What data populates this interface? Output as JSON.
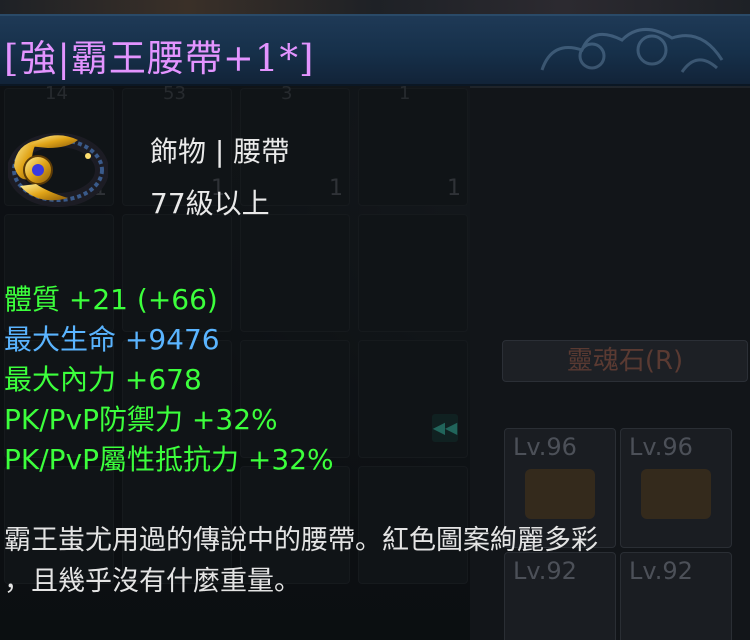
{
  "tooltip": {
    "title": "[強|霸王腰帶+1*]",
    "title_color": "#e394ff",
    "type": "飾物 | 腰帶",
    "level_req": "77級以上",
    "icon": "belt-icon",
    "stats": [
      {
        "text": "體質 +21 (+66)",
        "color": "#3cff3c"
      },
      {
        "text": "最大生命 +9476",
        "color": "#5ab4ff"
      },
      {
        "text": "最大內力 +678",
        "color": "#3cff3c"
      },
      {
        "text": "PK/PvP防禦力 +32%",
        "color": "#3cff3c"
      },
      {
        "text": "PK/PvP屬性抵抗力 +32%",
        "color": "#3cff3c"
      }
    ],
    "description_lines": [
      "霸王蚩尤用過的傳說中的腰帶。紅色圖案絢麗多彩",
      "，且幾乎沒有什麼重量。"
    ]
  },
  "background": {
    "slot_counts": [
      "1",
      "1",
      "1",
      "1"
    ],
    "top_counts": [
      "14",
      "53",
      "3",
      "1"
    ],
    "right_header": "靈魂石(R)",
    "right_levels": [
      "Lv.96",
      "Lv.96",
      "Lv.92",
      "Lv.92"
    ]
  }
}
